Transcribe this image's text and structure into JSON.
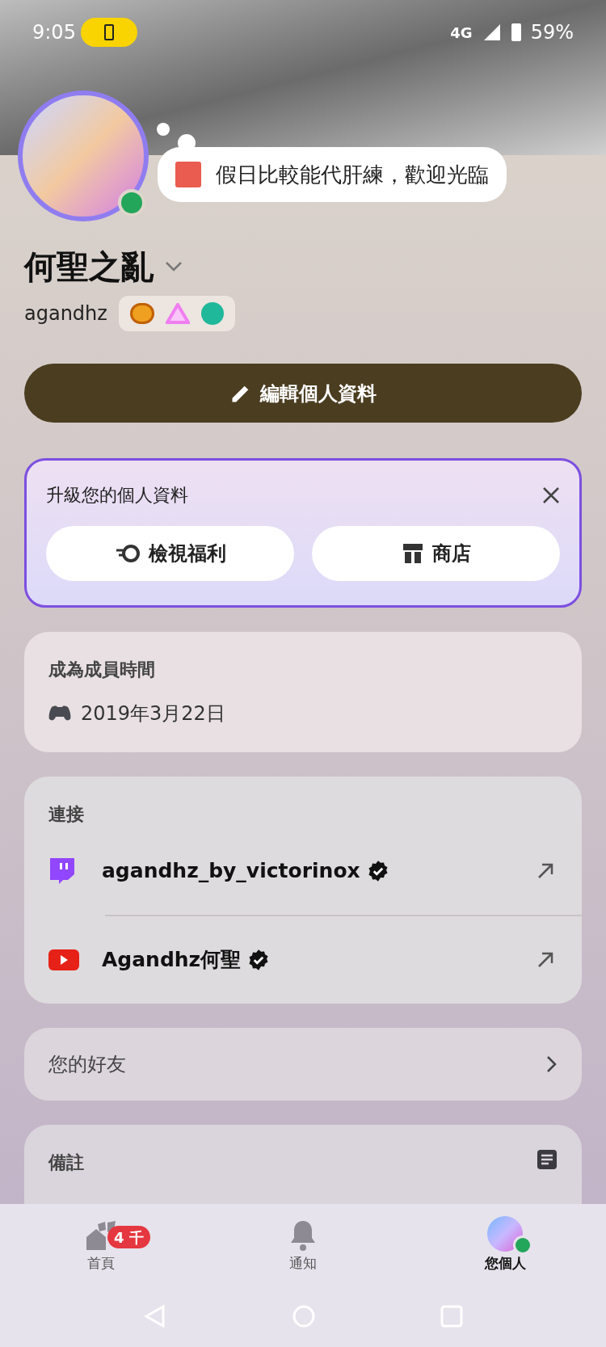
{
  "status_bar": {
    "time": "9:05",
    "network": "4G",
    "battery": "59%"
  },
  "profile": {
    "custom_status": "假日比較能代肝練，歡迎光臨",
    "display_name": "何聖之亂",
    "username": "agandhz",
    "online": true
  },
  "edit_button": "編輯個人資料",
  "upgrade_card": {
    "title": "升級您的個人資料",
    "buttons": [
      {
        "kind": "perks",
        "label": "檢視福利"
      },
      {
        "kind": "shop",
        "label": "商店"
      }
    ]
  },
  "member_since": {
    "title": "成為成員時間",
    "date": "2019年3月22日"
  },
  "connections": {
    "title": "連接",
    "items": [
      {
        "kind": "twitch",
        "name": "agandhz_by_victorinox",
        "verified": true
      },
      {
        "kind": "youtube",
        "name": "Agandhz何聖",
        "verified": true
      }
    ]
  },
  "friends": {
    "label": "您的好友"
  },
  "notes": {
    "title": "備註"
  },
  "tabs": [
    {
      "kind": "home",
      "label": "首頁",
      "badge": "4 千",
      "selected": false
    },
    {
      "kind": "notifications",
      "label": "通知",
      "selected": false
    },
    {
      "kind": "you",
      "label": "您個人",
      "selected": true
    }
  ]
}
